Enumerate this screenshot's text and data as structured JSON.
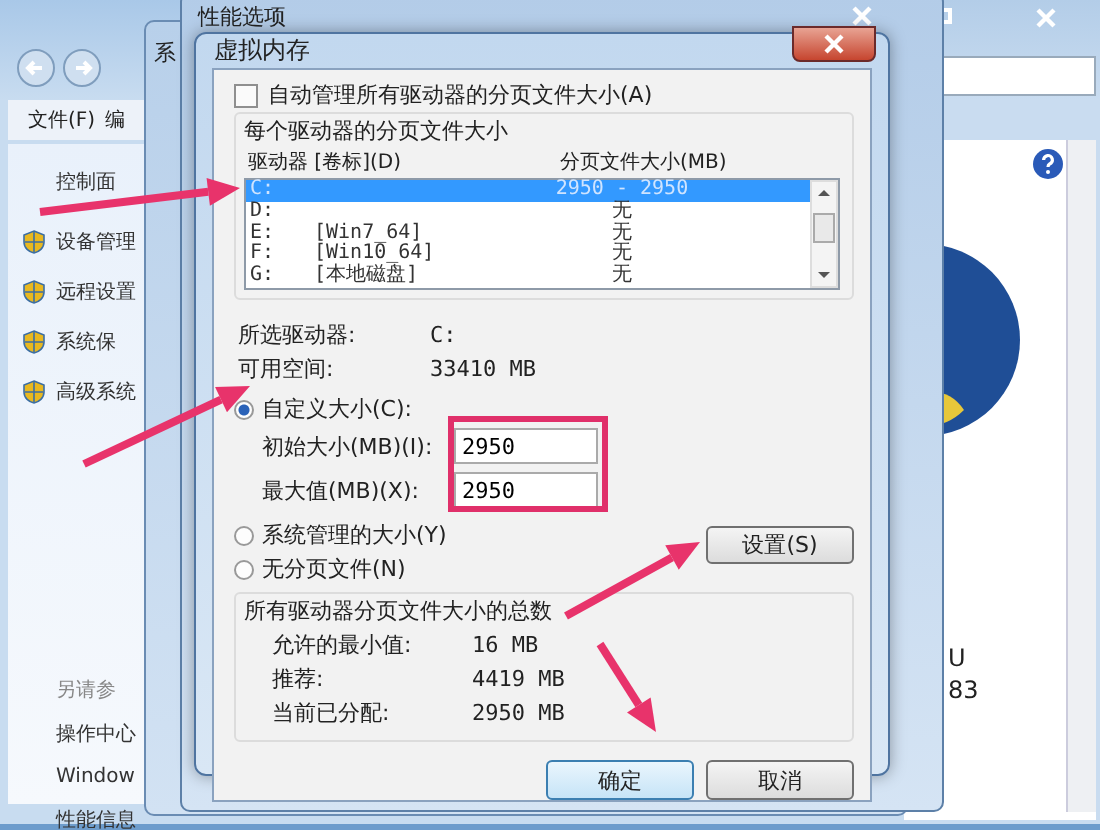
{
  "back_window": {
    "title": "系",
    "menu": [
      "文件(F)",
      "编"
    ],
    "sidebar": {
      "top_link": "控制面",
      "tasks": [
        "设备管理",
        "远程设置",
        "系统保",
        "高级系统"
      ],
      "see_also_heading": "另请参",
      "see_also": [
        "操作中心",
        "Window",
        "性能信息"
      ]
    },
    "info_fragments": [
      "U",
      "83"
    ]
  },
  "middle_window": {
    "title": "性能选项"
  },
  "dialog": {
    "title": "虚拟内存",
    "auto_manage": {
      "label": "自动管理所有驱动器的分页文件大小(A)",
      "checked": false
    },
    "per_drive": {
      "heading": "每个驱动器的分页文件大小",
      "columns": [
        "驱动器 [卷标](D)",
        "分页文件大小(MB)"
      ],
      "rows": [
        {
          "drive": "C:",
          "size": "2950 - 2950",
          "selected": true
        },
        {
          "drive": "D:",
          "size": "无",
          "selected": false
        },
        {
          "drive": "E:",
          "label": "[Win7_64]",
          "size": "无",
          "selected": false
        },
        {
          "drive": "F:",
          "label": "[Win10_64]",
          "size": "无",
          "selected": false
        },
        {
          "drive": "G:",
          "label": "[本地磁盘]",
          "size": "无",
          "selected": false
        }
      ]
    },
    "info": [
      {
        "label": "所选驱动器:",
        "value": "C:"
      },
      {
        "label": "可用空间:",
        "value": "33410 MB"
      }
    ],
    "size_options": [
      {
        "kind": "custom",
        "label": "自定义大小(C):",
        "selected": true,
        "fields": [
          {
            "label": "初始大小(MB)(I):",
            "value": "2950"
          },
          {
            "label": "最大值(MB)(X):",
            "value": "2950"
          }
        ]
      },
      {
        "kind": "plain",
        "label": "系统管理的大小(Y)",
        "selected": false
      },
      {
        "kind": "plain",
        "label": "无分页文件(N)",
        "selected": false
      }
    ],
    "set_button": "设置(S)",
    "totals": {
      "heading": "所有驱动器分页文件大小的总数",
      "rows": [
        {
          "label": "允许的最小值:",
          "value": "16 MB"
        },
        {
          "label": "推荐:",
          "value": "4419 MB"
        },
        {
          "label": "当前已分配:",
          "value": "2950 MB"
        }
      ]
    },
    "buttons": [
      {
        "label": "确定",
        "default": true
      },
      {
        "label": "取消",
        "default": false
      }
    ]
  }
}
